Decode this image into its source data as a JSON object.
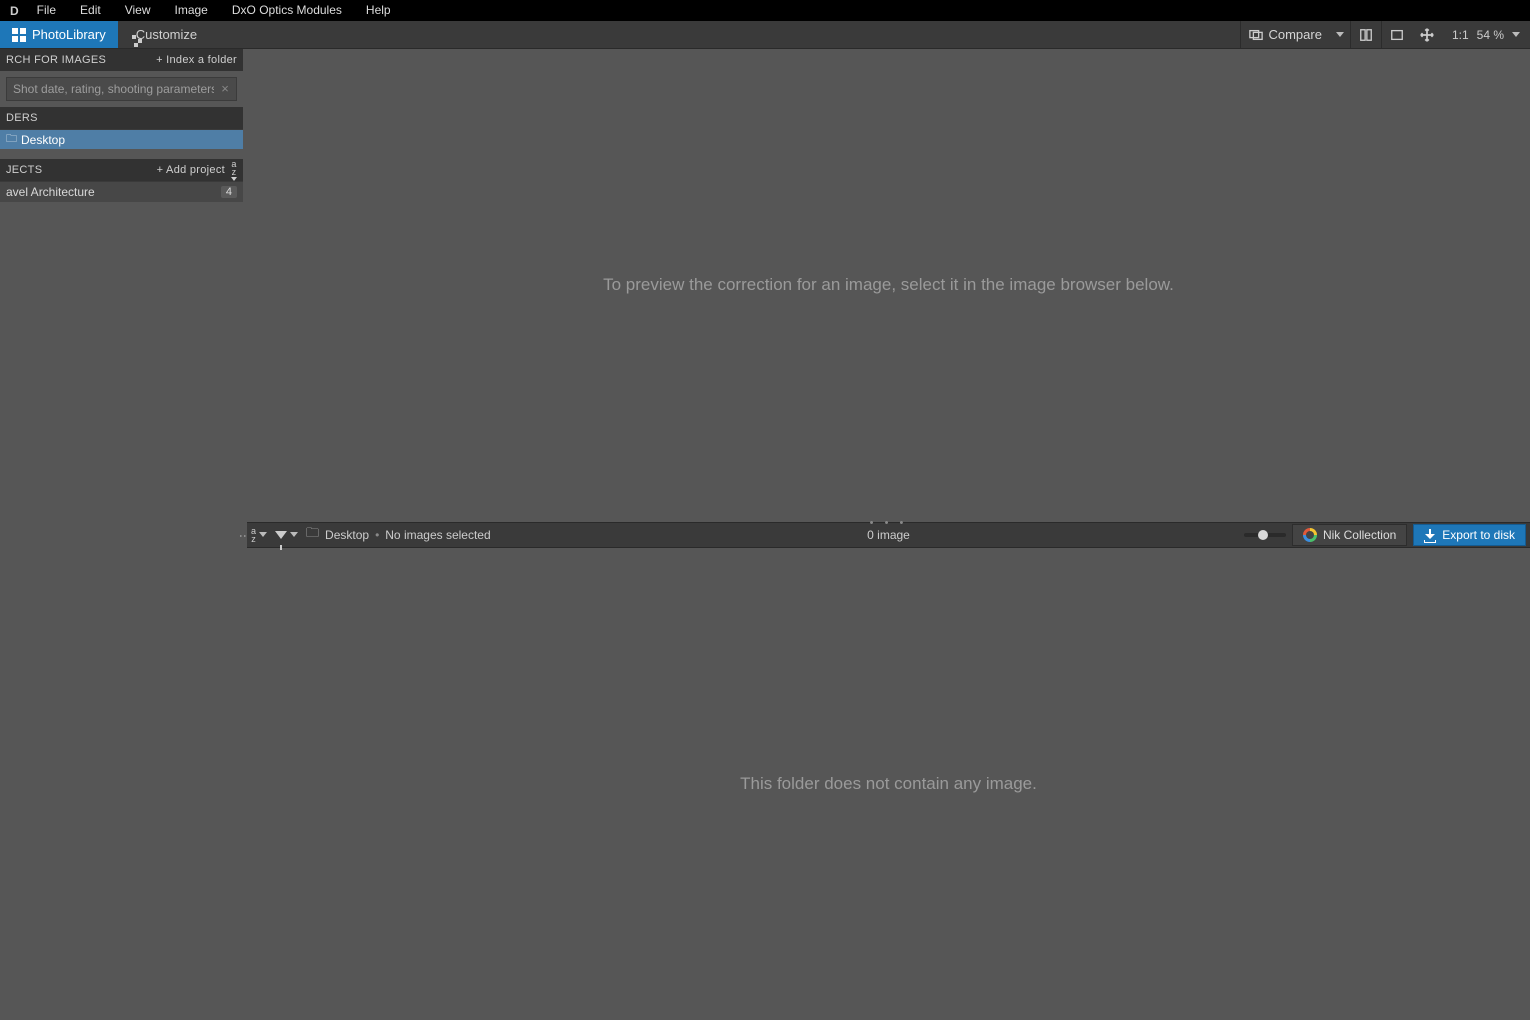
{
  "menubar": {
    "logo": "D",
    "items": [
      "File",
      "Edit",
      "View",
      "Image",
      "DxO Optics Modules",
      "Help"
    ]
  },
  "toolbar": {
    "photolibrary_label": "PhotoLibrary",
    "customize_label": "Customize",
    "compare_label": "Compare",
    "ratio_label": "1:1",
    "zoom_label": "54 %"
  },
  "sidebar": {
    "search": {
      "header": "RCH FOR IMAGES",
      "index_action": "+ Index a folder",
      "placeholder": "Shot date, rating, shooting parameters..."
    },
    "folders": {
      "header": "DERS",
      "selected": "Desktop"
    },
    "projects": {
      "header": "JECTS",
      "add_action": "+ Add project",
      "items": [
        {
          "name": "avel Architecture",
          "count": "4"
        }
      ]
    }
  },
  "preview": {
    "message": "To preview the correction for an image, select it in the image browser below."
  },
  "browser_bar": {
    "folder": "Desktop",
    "selection": "No images selected",
    "count": "0 image",
    "nik_label": "Nik Collection",
    "export_label": "Export to disk"
  },
  "browser_body": {
    "message": "This folder does not contain any image."
  }
}
